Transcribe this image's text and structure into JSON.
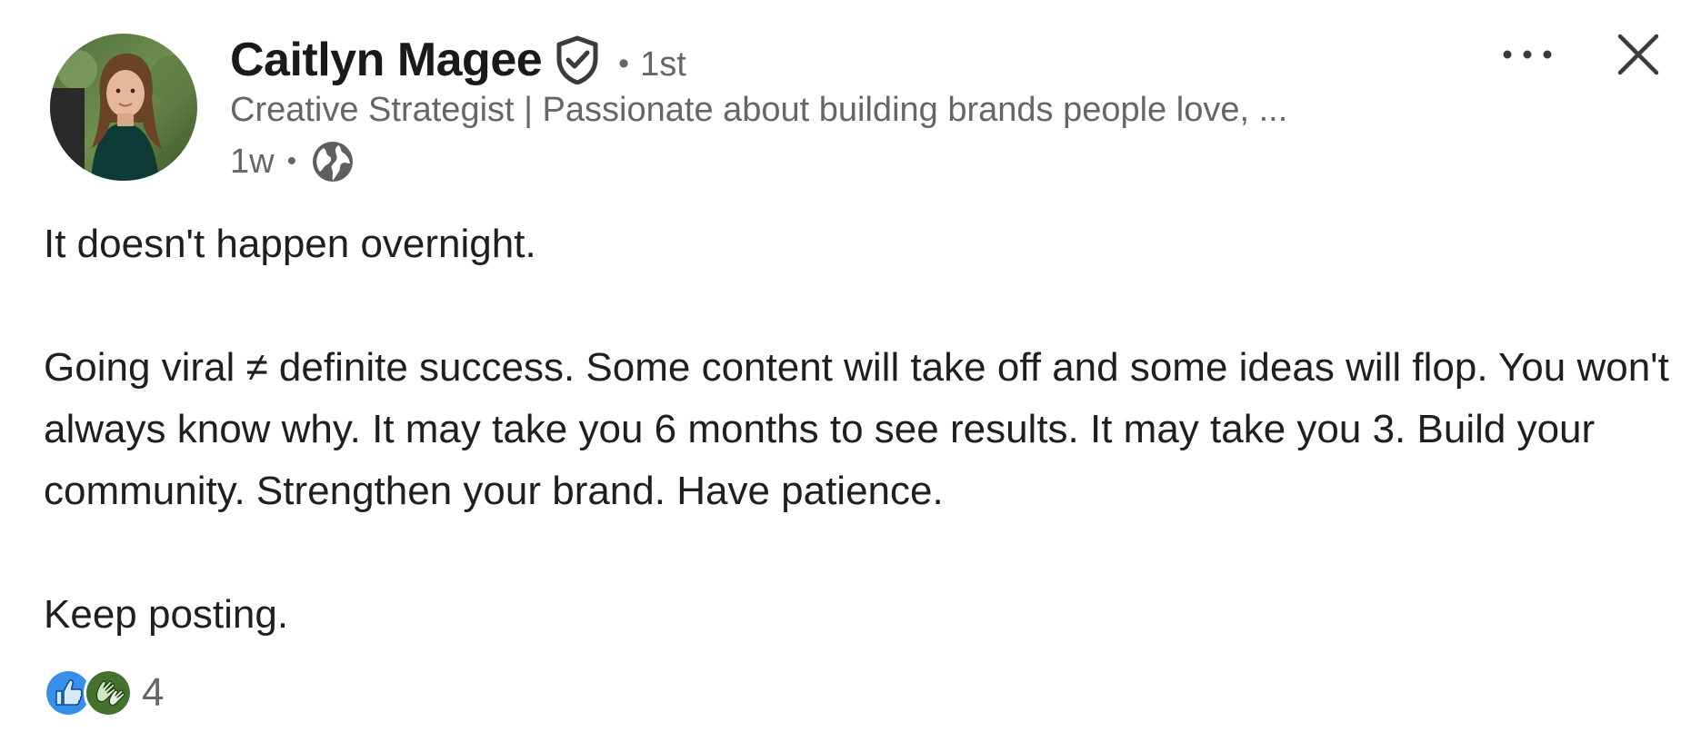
{
  "author": {
    "name": "Caitlyn Magee",
    "connection_degree": "1st",
    "separator": "•",
    "headline": "Creative Strategist | Passionate about building brands people love, ...",
    "post_age": "1w",
    "meta_separator": "•",
    "avatar_icon": "profile-photo",
    "verified_icon": "verified-shield-icon",
    "visibility_icon": "globe-icon"
  },
  "actions": {
    "more_icon": "ellipsis-icon",
    "close_icon": "close-icon"
  },
  "post": {
    "paragraphs": [
      "It doesn't happen overnight.",
      "Going viral ≠ definite success. Some content will take off and some ideas will flop. You won't always know why. It may take you 6 months to see results. It may take you 3. Build your community. Strengthen your brand. Have patience.",
      "Keep posting."
    ]
  },
  "reactions": {
    "types": [
      "like",
      "celebrate"
    ],
    "count": "4",
    "colors": {
      "like": "#378fe9",
      "celebrate": "#44712e"
    }
  },
  "colors": {
    "text_primary": "#1f1f1f",
    "text_secondary": "#666666",
    "background": "#ffffff"
  }
}
